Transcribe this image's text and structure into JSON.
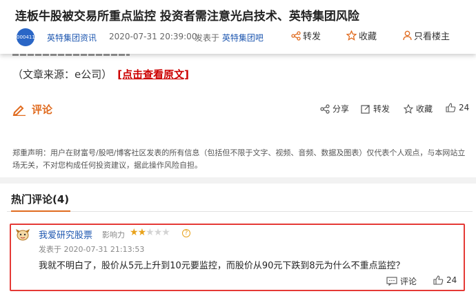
{
  "header": {
    "title": "连板牛股被交易所重点监控 投资者需注意光启技术、英特集团风险",
    "avatar_text": "000411",
    "author": "英特集团资讯",
    "publish_time": "2020-07-31 20:39:00",
    "posted_in_prefix": "发表于",
    "posted_in_bar": "英特集团吧",
    "actions": {
      "share": "转发",
      "favorite": "收藏",
      "author_only": "只看楼主"
    }
  },
  "article": {
    "source_text": "（文章来源：e公司）",
    "source_link": "[点击查看原文]",
    "comment_label": "评论",
    "actions": {
      "share": "分享",
      "forward": "转发",
      "favorite": "收藏",
      "likes": "24"
    },
    "disclaimer": "郑重声明：用户在财富号/股吧/博客社区发表的所有信息（包括但不限于文字、视频、音频、数据及图表）仅代表个人观点，与本网站立场无关，不对您构成任何投资建议，据此操作风险自担。"
  },
  "hot_comments": {
    "title": "热门评论(4)",
    "items": [
      {
        "user": "我爱研究股票",
        "influence_label": "影响力",
        "stars": 2,
        "stars_max": 5,
        "help": "?",
        "time": "发表于 2020-07-31 21:13:53",
        "text": "我就不明白了，股价从5元上升到10元要监控，而股价从90元下跌到8元为什么不重点监控？",
        "reply_label": "评论",
        "likes": "24"
      }
    ]
  },
  "colors": {
    "accent": "#e06b1f",
    "link": "#1e57b0",
    "highlight": "#e53935",
    "star": "#e8a21b"
  }
}
